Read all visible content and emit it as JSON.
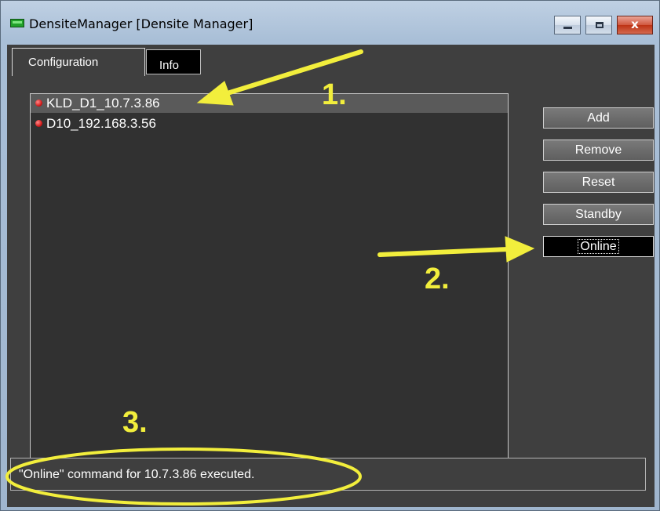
{
  "window": {
    "title": "DensiteManager [Densite Manager]",
    "close_glyph": "x",
    "accent": "#1f9a2a"
  },
  "tabs": [
    {
      "label": "Configuration",
      "selected": true
    },
    {
      "label": "Info",
      "selected": false
    }
  ],
  "devices": [
    {
      "name": "KLD_D1_10.7.3.86",
      "status_color": "#e02020",
      "selected": true
    },
    {
      "name": "D10_192.168.3.56",
      "status_color": "#e02020",
      "selected": false
    }
  ],
  "buttons": {
    "add": "Add",
    "remove": "Remove",
    "reset": "Reset",
    "standby": "Standby",
    "online": "Online"
  },
  "status_message": "\"Online\" command for 10.7.3.86 executed.",
  "annotations": {
    "step1": "1.",
    "step2": "2.",
    "step3": "3.",
    "color": "#f2ee3c"
  }
}
